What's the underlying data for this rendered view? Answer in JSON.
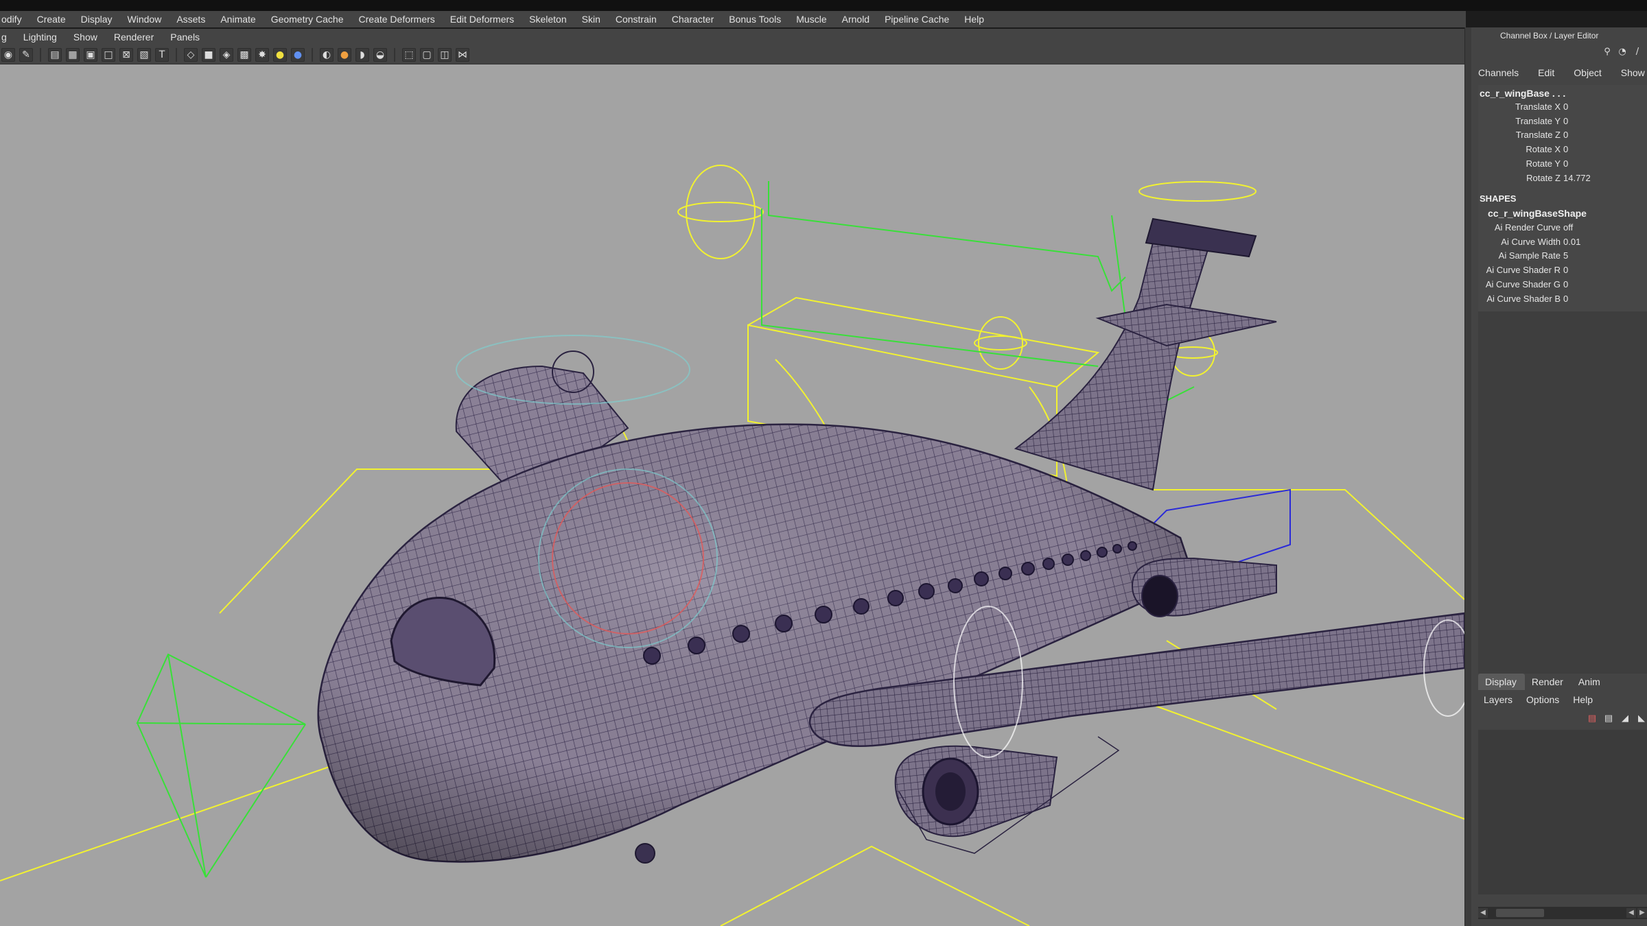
{
  "menubar": {
    "items": [
      "odify",
      "Create",
      "Display",
      "Window",
      "Assets",
      "Animate",
      "Geometry Cache",
      "Create Deformers",
      "Edit Deformers",
      "Skeleton",
      "Skin",
      "Constrain",
      "Character",
      "Bonus Tools",
      "Muscle",
      "Arnold",
      "Pipeline Cache",
      "Help"
    ]
  },
  "panel_menu": {
    "items": [
      "g",
      "Lighting",
      "Show",
      "Renderer",
      "Panels"
    ]
  },
  "toolbar": {
    "icons": [
      "camera-icon",
      "bookmark-icon",
      "image-plane-icon",
      "grid-icon",
      "film-gate-icon",
      "resolution-gate-icon",
      "safe-area-icon",
      "hud-icon",
      "field-chart-icon",
      "wireframe-icon",
      "smooth-shade-icon",
      "wireframe-on-shaded-icon",
      "textured-icon",
      "lights-icon",
      "shadows-icon",
      "ambient-occlusion-icon",
      "xray-icon",
      "isolate-icon",
      "motion-blur-icon",
      "multisample-icon",
      "dof-icon"
    ]
  },
  "channel_box": {
    "title": "Channel Box / Layer Editor",
    "tabs": [
      "Channels",
      "Edit",
      "Object",
      "Show"
    ],
    "object_name": "cc_r_wingBase . . .",
    "attributes": [
      {
        "label": "Translate X",
        "value": "0"
      },
      {
        "label": "Translate Y",
        "value": "0"
      },
      {
        "label": "Translate Z",
        "value": "0"
      },
      {
        "label": "Rotate X",
        "value": "0"
      },
      {
        "label": "Rotate Y",
        "value": "0"
      },
      {
        "label": "Rotate Z",
        "value": "14.772"
      }
    ],
    "shapes_header": "SHAPES",
    "shape_name": "cc_r_wingBaseShape",
    "shape_attributes": [
      {
        "label": "Ai Render Curve",
        "value": "off"
      },
      {
        "label": "Ai Curve Width",
        "value": "0.01"
      },
      {
        "label": "Ai Sample Rate",
        "value": "5"
      },
      {
        "label": "Ai Curve Shader R",
        "value": "0"
      },
      {
        "label": "Ai Curve Shader G",
        "value": "0"
      },
      {
        "label": "Ai Curve Shader B",
        "value": "0"
      }
    ]
  },
  "layer_editor": {
    "tabs": [
      "Display",
      "Render",
      "Anim"
    ],
    "active_tab": "Display",
    "menus": [
      "Layers",
      "Options",
      "Help"
    ]
  },
  "colors": {
    "viewport_bg": "#a3a3a3",
    "wire_purple": "#5a4e78",
    "curve_yellow": "#f2f230",
    "curve_green": "#38e038",
    "curve_blue": "#2a2ad8"
  }
}
